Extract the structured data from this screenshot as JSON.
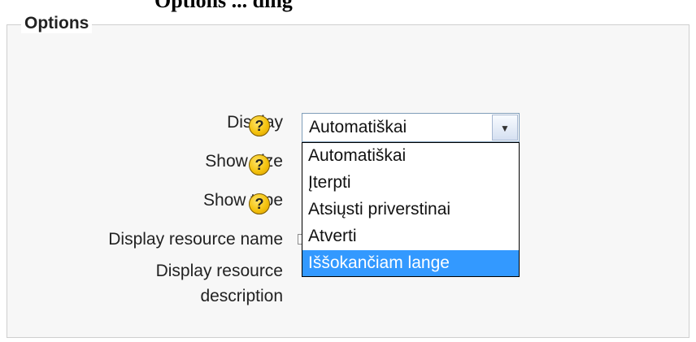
{
  "page": {
    "top_title_fragment": "Options ... ding"
  },
  "fieldset": {
    "legend": "Options"
  },
  "form": {
    "fields": [
      {
        "label": "Display",
        "help": "?"
      },
      {
        "label": "Show size",
        "help": "?"
      },
      {
        "label": "Show type",
        "help": "?"
      },
      {
        "label": "Display resource name"
      },
      {
        "label_line1": "Display resource",
        "label_line2": "description"
      }
    ]
  },
  "select": {
    "current_value": "Automatiškai",
    "options": [
      "Automatiškai",
      "Įterpti",
      "Atsiųsti priverstinai",
      "Atverti",
      "Iššokančiam lange"
    ],
    "highlighted_index": 4
  },
  "colors": {
    "highlight": "#3399ff",
    "help_icon": "#f4c20d"
  }
}
